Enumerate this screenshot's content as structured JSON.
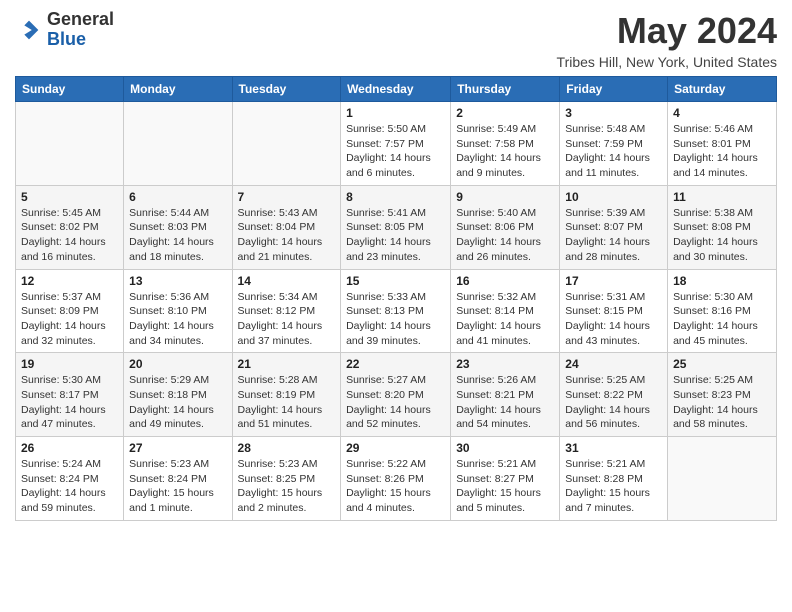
{
  "header": {
    "logo": {
      "general": "General",
      "blue": "Blue"
    },
    "title": "May 2024",
    "location": "Tribes Hill, New York, United States"
  },
  "calendar": {
    "days_of_week": [
      "Sunday",
      "Monday",
      "Tuesday",
      "Wednesday",
      "Thursday",
      "Friday",
      "Saturday"
    ],
    "weeks": [
      [
        {
          "day": "",
          "info": ""
        },
        {
          "day": "",
          "info": ""
        },
        {
          "day": "",
          "info": ""
        },
        {
          "day": "1",
          "info": "Sunrise: 5:50 AM\nSunset: 7:57 PM\nDaylight: 14 hours\nand 6 minutes."
        },
        {
          "day": "2",
          "info": "Sunrise: 5:49 AM\nSunset: 7:58 PM\nDaylight: 14 hours\nand 9 minutes."
        },
        {
          "day": "3",
          "info": "Sunrise: 5:48 AM\nSunset: 7:59 PM\nDaylight: 14 hours\nand 11 minutes."
        },
        {
          "day": "4",
          "info": "Sunrise: 5:46 AM\nSunset: 8:01 PM\nDaylight: 14 hours\nand 14 minutes."
        }
      ],
      [
        {
          "day": "5",
          "info": "Sunrise: 5:45 AM\nSunset: 8:02 PM\nDaylight: 14 hours\nand 16 minutes."
        },
        {
          "day": "6",
          "info": "Sunrise: 5:44 AM\nSunset: 8:03 PM\nDaylight: 14 hours\nand 18 minutes."
        },
        {
          "day": "7",
          "info": "Sunrise: 5:43 AM\nSunset: 8:04 PM\nDaylight: 14 hours\nand 21 minutes."
        },
        {
          "day": "8",
          "info": "Sunrise: 5:41 AM\nSunset: 8:05 PM\nDaylight: 14 hours\nand 23 minutes."
        },
        {
          "day": "9",
          "info": "Sunrise: 5:40 AM\nSunset: 8:06 PM\nDaylight: 14 hours\nand 26 minutes."
        },
        {
          "day": "10",
          "info": "Sunrise: 5:39 AM\nSunset: 8:07 PM\nDaylight: 14 hours\nand 28 minutes."
        },
        {
          "day": "11",
          "info": "Sunrise: 5:38 AM\nSunset: 8:08 PM\nDaylight: 14 hours\nand 30 minutes."
        }
      ],
      [
        {
          "day": "12",
          "info": "Sunrise: 5:37 AM\nSunset: 8:09 PM\nDaylight: 14 hours\nand 32 minutes."
        },
        {
          "day": "13",
          "info": "Sunrise: 5:36 AM\nSunset: 8:10 PM\nDaylight: 14 hours\nand 34 minutes."
        },
        {
          "day": "14",
          "info": "Sunrise: 5:34 AM\nSunset: 8:12 PM\nDaylight: 14 hours\nand 37 minutes."
        },
        {
          "day": "15",
          "info": "Sunrise: 5:33 AM\nSunset: 8:13 PM\nDaylight: 14 hours\nand 39 minutes."
        },
        {
          "day": "16",
          "info": "Sunrise: 5:32 AM\nSunset: 8:14 PM\nDaylight: 14 hours\nand 41 minutes."
        },
        {
          "day": "17",
          "info": "Sunrise: 5:31 AM\nSunset: 8:15 PM\nDaylight: 14 hours\nand 43 minutes."
        },
        {
          "day": "18",
          "info": "Sunrise: 5:30 AM\nSunset: 8:16 PM\nDaylight: 14 hours\nand 45 minutes."
        }
      ],
      [
        {
          "day": "19",
          "info": "Sunrise: 5:30 AM\nSunset: 8:17 PM\nDaylight: 14 hours\nand 47 minutes."
        },
        {
          "day": "20",
          "info": "Sunrise: 5:29 AM\nSunset: 8:18 PM\nDaylight: 14 hours\nand 49 minutes."
        },
        {
          "day": "21",
          "info": "Sunrise: 5:28 AM\nSunset: 8:19 PM\nDaylight: 14 hours\nand 51 minutes."
        },
        {
          "day": "22",
          "info": "Sunrise: 5:27 AM\nSunset: 8:20 PM\nDaylight: 14 hours\nand 52 minutes."
        },
        {
          "day": "23",
          "info": "Sunrise: 5:26 AM\nSunset: 8:21 PM\nDaylight: 14 hours\nand 54 minutes."
        },
        {
          "day": "24",
          "info": "Sunrise: 5:25 AM\nSunset: 8:22 PM\nDaylight: 14 hours\nand 56 minutes."
        },
        {
          "day": "25",
          "info": "Sunrise: 5:25 AM\nSunset: 8:23 PM\nDaylight: 14 hours\nand 58 minutes."
        }
      ],
      [
        {
          "day": "26",
          "info": "Sunrise: 5:24 AM\nSunset: 8:24 PM\nDaylight: 14 hours\nand 59 minutes."
        },
        {
          "day": "27",
          "info": "Sunrise: 5:23 AM\nSunset: 8:24 PM\nDaylight: 15 hours\nand 1 minute."
        },
        {
          "day": "28",
          "info": "Sunrise: 5:23 AM\nSunset: 8:25 PM\nDaylight: 15 hours\nand 2 minutes."
        },
        {
          "day": "29",
          "info": "Sunrise: 5:22 AM\nSunset: 8:26 PM\nDaylight: 15 hours\nand 4 minutes."
        },
        {
          "day": "30",
          "info": "Sunrise: 5:21 AM\nSunset: 8:27 PM\nDaylight: 15 hours\nand 5 minutes."
        },
        {
          "day": "31",
          "info": "Sunrise: 5:21 AM\nSunset: 8:28 PM\nDaylight: 15 hours\nand 7 minutes."
        },
        {
          "day": "",
          "info": ""
        }
      ]
    ]
  }
}
